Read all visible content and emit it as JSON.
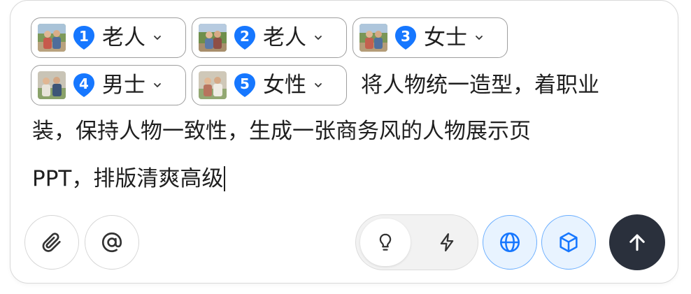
{
  "mentions": [
    {
      "number": "1",
      "label": "老人"
    },
    {
      "number": "2",
      "label": "老人"
    },
    {
      "number": "3",
      "label": "女士"
    },
    {
      "number": "4",
      "label": "男士"
    },
    {
      "number": "5",
      "label": "女性"
    }
  ],
  "prompt": {
    "line1": "将人物统一造型，着职业",
    "line2": "装，保持人物一致性，生成一张商务风的人物展示页",
    "line3": "PPT，排版清爽高级"
  },
  "toolbar": {
    "attach_icon": "paperclip-icon",
    "mention_icon": "at-sign-icon",
    "think_icon": "lightbulb-icon",
    "fast_icon": "lightning-icon",
    "web_icon": "globe-icon",
    "model_icon": "cube-icon",
    "send_icon": "arrow-up-icon",
    "active_mode": "think"
  },
  "colors": {
    "badge_blue": "#1677ff",
    "accent_blue": "#1677ff",
    "toggle_active_bg": "#e8f3ff",
    "send_bg": "#2a303c"
  }
}
